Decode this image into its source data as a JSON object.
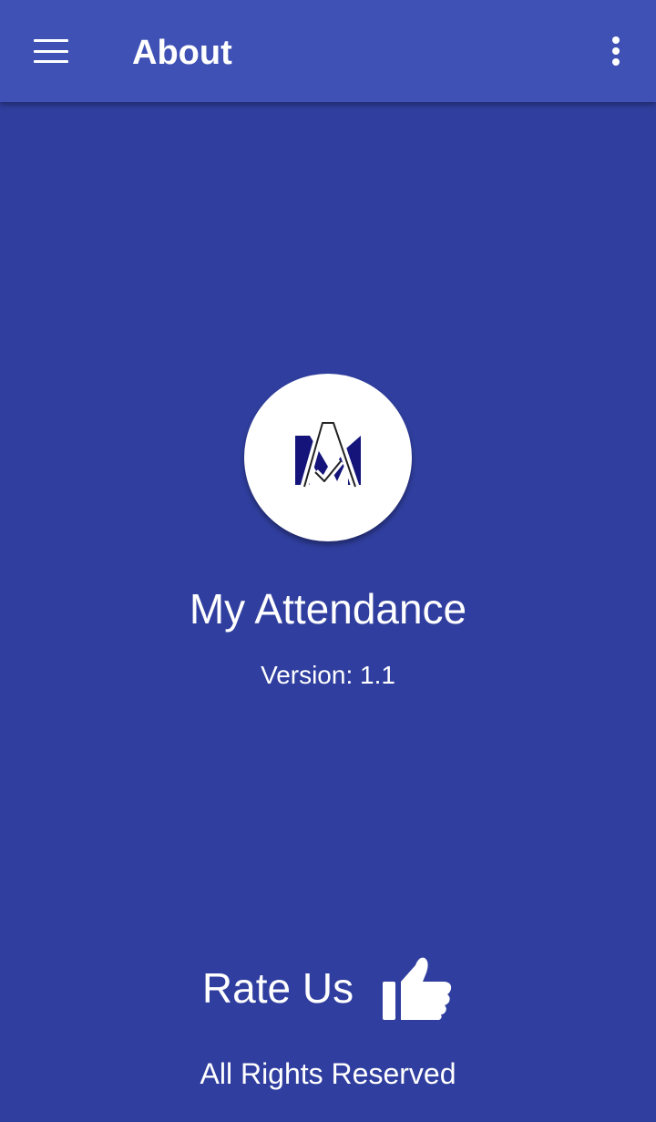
{
  "app_bar": {
    "title": "About",
    "menu_icon": "hamburger-menu-icon",
    "overflow_icon": "more-vert-icon",
    "background": "#3f51b5"
  },
  "content": {
    "background": "#303f9f",
    "logo_icon": "my-attendance-logo",
    "app_name": "My Attendance",
    "version_text": "Version: 1.1"
  },
  "footer": {
    "rate_label": "Rate Us",
    "rate_icon": "thumbs-up-icon",
    "rights_text": "All Rights Reserved"
  }
}
